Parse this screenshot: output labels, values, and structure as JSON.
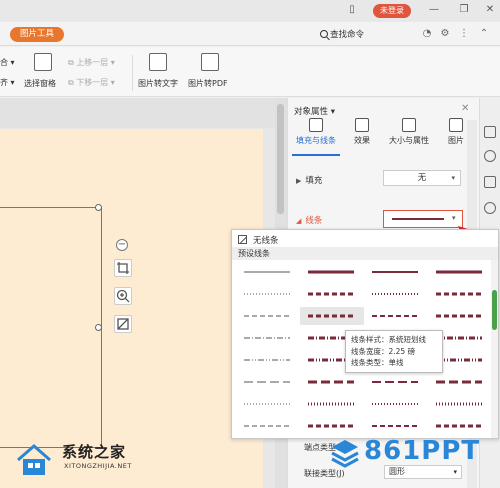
{
  "titlebar": {
    "login_label": "未登录"
  },
  "tabrow": {
    "picture_tools_label": "图片工具",
    "search_label": "查找命令"
  },
  "ribbon": {
    "combine_label": "合",
    "align_label": "齐",
    "selection_pane_label": "选择窗格",
    "bring_forward_label": "上移一层",
    "send_backward_label": "下移一层",
    "pic_to_text_label": "图片转文字",
    "pic_to_pdf_label": "图片转PDF"
  },
  "pane": {
    "title": "对象属性",
    "tabs": [
      {
        "label": "填充与线条"
      },
      {
        "label": "效果"
      },
      {
        "label": "大小与属性"
      },
      {
        "label": "图片"
      }
    ],
    "fill_label": "填充",
    "fill_value": "无",
    "line_label": "线条",
    "dash_type_label": "端点类型",
    "join_type_label": "联接类型(J)",
    "join_type_value": "圆形"
  },
  "popup": {
    "no_line_label": "无线条",
    "preset_header": "预设线条"
  },
  "tooltip": {
    "style_line": "线条样式：系统短划线",
    "width_line": "线条宽度：2.25 磅",
    "type_line": "线条类型：单线"
  },
  "watermark_left": {
    "title": "系统之家",
    "url": "XITONGZHIJIA.NET"
  },
  "watermark_right": {
    "text": "861PPT"
  },
  "colors": {
    "accent": "#e8762d",
    "login": "#e0553e",
    "line": "#7a2a3a",
    "tab_active": "#2a6fd6",
    "brand_blue": "#2a86d6"
  }
}
